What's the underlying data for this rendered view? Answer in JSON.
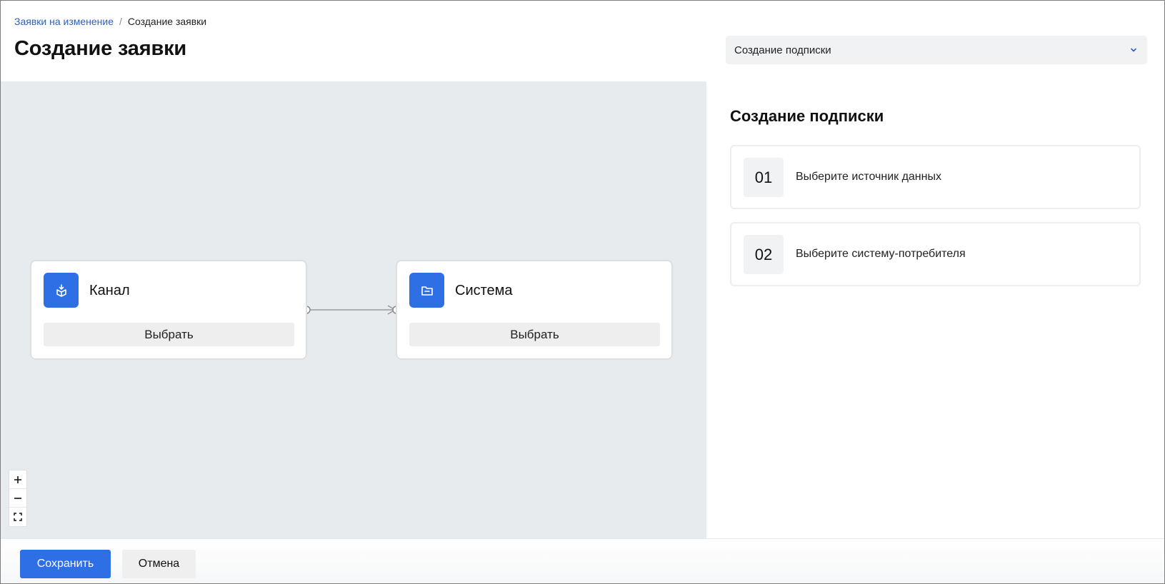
{
  "breadcrumb": {
    "parent": "Заявки на изменение",
    "separator": "/",
    "current": "Создание заявки"
  },
  "page_title": "Создание заявки",
  "type_select": {
    "value": "Создание подписки",
    "icon": "chevron-down-icon"
  },
  "canvas": {
    "nodes": [
      {
        "label": "Канал",
        "button": "Выбрать",
        "icon": "package-download-icon"
      },
      {
        "label": "Система",
        "button": "Выбрать",
        "icon": "folder-icon"
      }
    ],
    "zoom_controls": [
      "+",
      "−",
      "fit"
    ]
  },
  "panel": {
    "title": "Создание подписки",
    "steps": [
      {
        "number": "01",
        "text": "Выберите источник данных"
      },
      {
        "number": "02",
        "text": "Выберите систему-потребителя"
      }
    ]
  },
  "footer": {
    "save": "Сохранить",
    "cancel": "Отмена"
  },
  "colors": {
    "accent": "#2f6fe6",
    "link": "#2f5fbf",
    "canvas_bg": "#e8ebee"
  }
}
